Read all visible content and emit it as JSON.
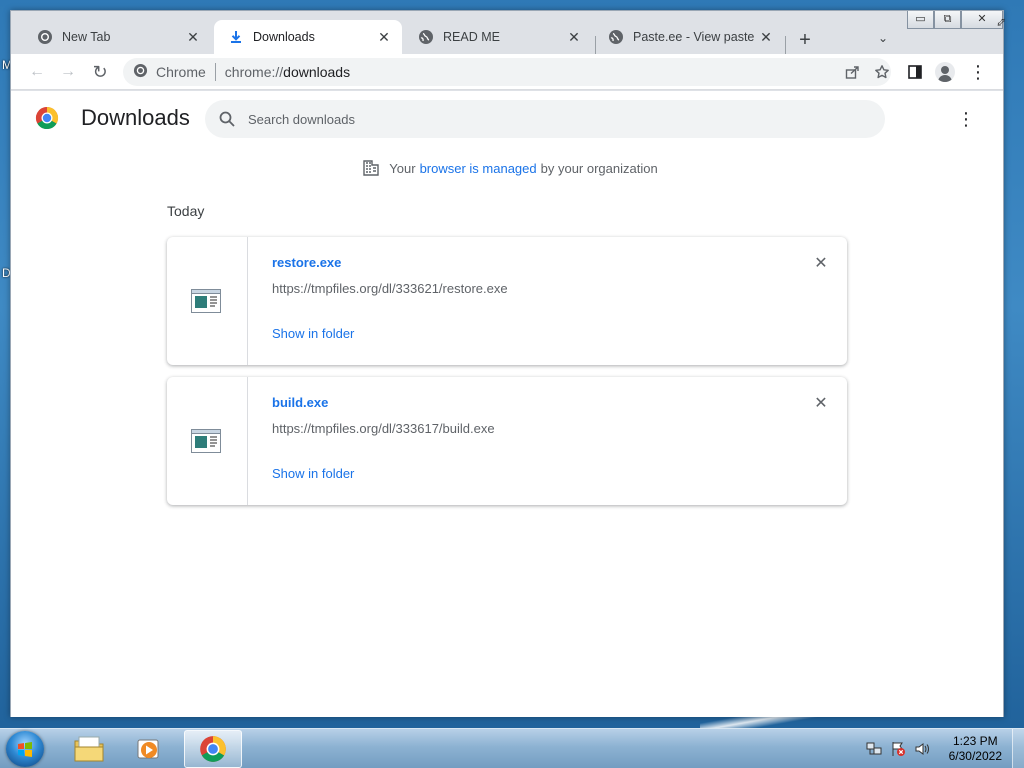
{
  "desktop": {
    "edge_letters": [
      "M",
      "D"
    ]
  },
  "window": {
    "controls": {
      "minimize": "▭",
      "maximize": "⧉",
      "close": "✕"
    }
  },
  "tabs": [
    {
      "title": "New Tab",
      "close": "✕",
      "icon": "chrome-icon",
      "active": false
    },
    {
      "title": "Downloads",
      "close": "✕",
      "icon": "download-icon",
      "active": true
    },
    {
      "title": "READ ME",
      "close": "✕",
      "icon": "globe-icon",
      "active": false
    },
    {
      "title": "Paste.ee - View paste zj",
      "close": "✕",
      "icon": "globe-icon",
      "active": false
    }
  ],
  "tabstrip": {
    "new_tab": "+",
    "tab_search": "⌄"
  },
  "toolbar": {
    "back": "←",
    "forward": "→",
    "reload": "↻",
    "site_chip": "Chrome",
    "url_scheme": "chrome://",
    "url_path": "downloads",
    "menu": "⋮"
  },
  "page": {
    "title": "Downloads",
    "search_placeholder": "Search downloads",
    "menu": "⋮",
    "managed": {
      "prefix": "Your",
      "link": "browser is managed",
      "suffix": "by your organization"
    },
    "day_label": "Today",
    "downloads": [
      {
        "name": "restore.exe",
        "url": "https://tmpfiles.org/dl/333621/restore.exe",
        "action": "Show in folder",
        "remove": "✕"
      },
      {
        "name": "build.exe",
        "url": "https://tmpfiles.org/dl/333617/build.exe",
        "action": "Show in folder",
        "remove": "✕"
      }
    ]
  },
  "taskbar": {
    "apps": [
      "file-explorer",
      "media-player",
      "chrome"
    ],
    "clock": {
      "time": "1:23 PM",
      "date": "6/30/2022"
    }
  },
  "colors": {
    "link": "#1a73e8",
    "tab_strip": "#dee1e6",
    "omnibox": "#f1f3f4"
  }
}
